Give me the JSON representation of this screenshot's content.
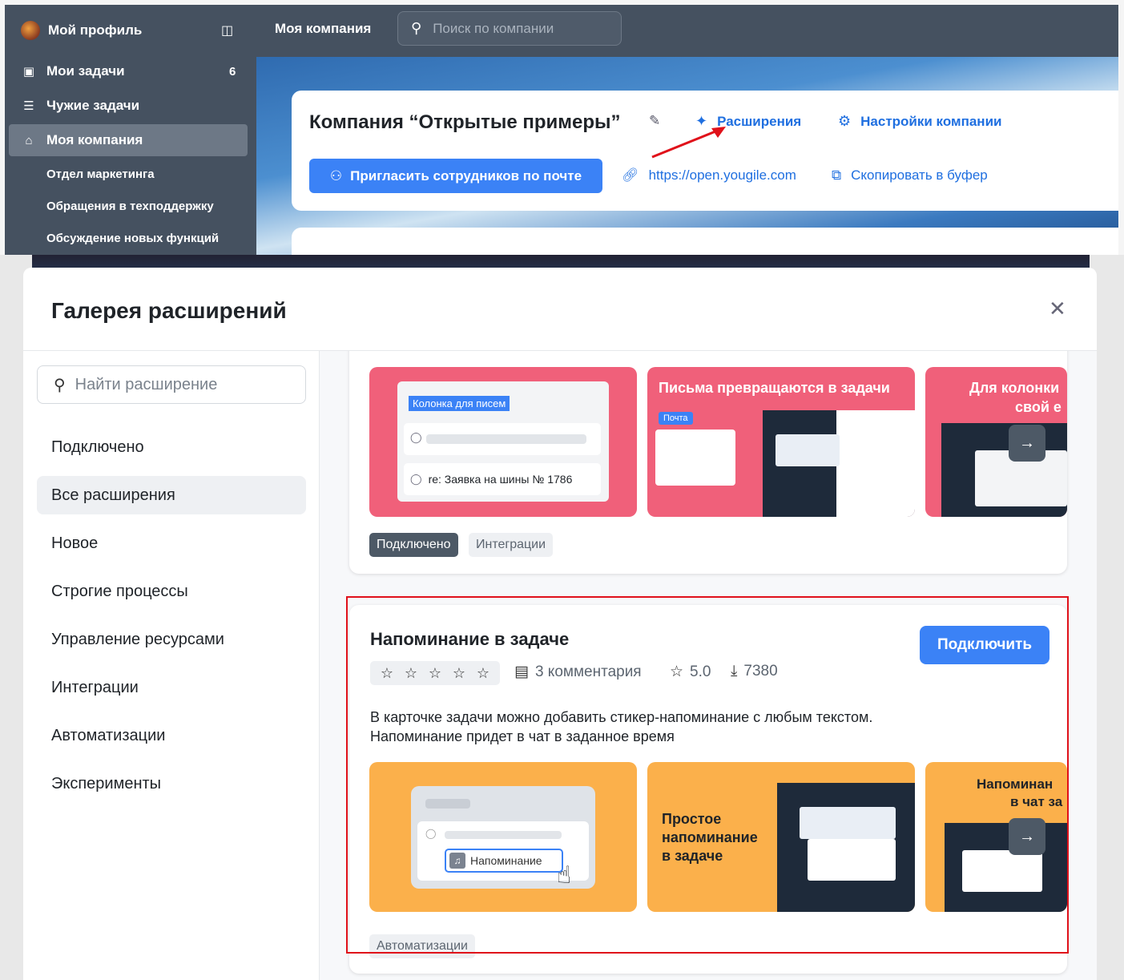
{
  "top": {
    "sidebar": {
      "profile_label": "Мой профиль",
      "items": [
        {
          "label": "Мои задачи",
          "count": "6"
        },
        {
          "label": "Чужие задачи"
        },
        {
          "label": "Моя компания"
        }
      ],
      "subitems": [
        "Отдел маркетинга",
        "Обращения в техподдержку",
        "Обсуждение новых функций"
      ]
    },
    "header": {
      "title": "Моя компания",
      "search_placeholder": "Поиск по компании"
    },
    "company": {
      "title": "Компания “Открытые примеры”",
      "extensions_link": "Расширения",
      "settings_link": "Настройки компании",
      "invite_button": "Пригласить сотрудников по почте",
      "url": "https://open.yougile.com",
      "copy_link": "Скопировать в буфер"
    }
  },
  "modal": {
    "title": "Галерея расширений",
    "search_placeholder": "Найти расширение",
    "categories": [
      "Подключено",
      "Все расширения",
      "Новое",
      "Строгие процессы",
      "Управление ресурсами",
      "Интеграции",
      "Автоматизации",
      "Эксперименты"
    ],
    "active_category": "Все расширения",
    "card_prev": {
      "slide1_label": "Колонка для писем",
      "slide1_task": "re: Заявка на шины № 1786",
      "slide2_title": "Письма превращаются в задачи",
      "slide2_badge": "Почта",
      "slide3_title_1": "Для колонки",
      "slide3_title_2": "свой е",
      "tags": [
        "Подключено",
        "Интеграции"
      ]
    },
    "card": {
      "name": "Напоминание в задаче",
      "connect_button": "Подключить",
      "comments": "3 комментария",
      "rating": "5.0",
      "downloads": "7380",
      "description_line1": "В карточке задачи можно добавить стикер-напоминание с любым текстом.",
      "description_line2": "Напоминание придет в чат в заданное время",
      "slide1_label": "Напоминание",
      "slide2_text_1": "Простое",
      "slide2_text_2": "напоминание",
      "slide2_text_3": "в задаче",
      "slide3_title_1": "Напоминан",
      "slide3_title_2": "в чат за",
      "tag": "Автоматизации"
    }
  },
  "colors": {
    "accent": "#3b82f6",
    "sidebar": "#455160",
    "highlight_frame": "#e0111a",
    "slide_pink": "#f0607a",
    "slide_orange": "#fbb04b"
  }
}
